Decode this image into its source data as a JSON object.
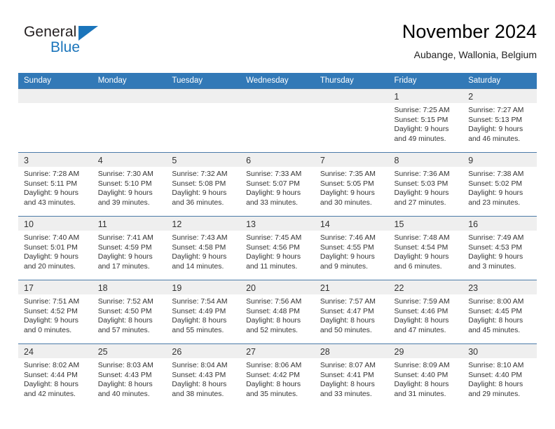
{
  "logo": {
    "word_one": "General",
    "word_two": "Blue",
    "triangle_icon": "blue-triangle-icon",
    "accent_color": "#1b75bb"
  },
  "header": {
    "title": "November 2024",
    "subtitle": "Aubange, Wallonia, Belgium",
    "header_bg_color": "#3279b7",
    "daynum_band_color": "#efefef"
  },
  "weekdays": [
    "Sunday",
    "Monday",
    "Tuesday",
    "Wednesday",
    "Thursday",
    "Friday",
    "Saturday"
  ],
  "weeks": [
    [
      {
        "day": "",
        "sunrise": "",
        "sunset": "",
        "daylight_line1": "",
        "daylight_line2": ""
      },
      {
        "day": "",
        "sunrise": "",
        "sunset": "",
        "daylight_line1": "",
        "daylight_line2": ""
      },
      {
        "day": "",
        "sunrise": "",
        "sunset": "",
        "daylight_line1": "",
        "daylight_line2": ""
      },
      {
        "day": "",
        "sunrise": "",
        "sunset": "",
        "daylight_line1": "",
        "daylight_line2": ""
      },
      {
        "day": "",
        "sunrise": "",
        "sunset": "",
        "daylight_line1": "",
        "daylight_line2": ""
      },
      {
        "day": "1",
        "sunrise": "Sunrise: 7:25 AM",
        "sunset": "Sunset: 5:15 PM",
        "daylight_line1": "Daylight: 9 hours",
        "daylight_line2": "and 49 minutes."
      },
      {
        "day": "2",
        "sunrise": "Sunrise: 7:27 AM",
        "sunset": "Sunset: 5:13 PM",
        "daylight_line1": "Daylight: 9 hours",
        "daylight_line2": "and 46 minutes."
      }
    ],
    [
      {
        "day": "3",
        "sunrise": "Sunrise: 7:28 AM",
        "sunset": "Sunset: 5:11 PM",
        "daylight_line1": "Daylight: 9 hours",
        "daylight_line2": "and 43 minutes."
      },
      {
        "day": "4",
        "sunrise": "Sunrise: 7:30 AM",
        "sunset": "Sunset: 5:10 PM",
        "daylight_line1": "Daylight: 9 hours",
        "daylight_line2": "and 39 minutes."
      },
      {
        "day": "5",
        "sunrise": "Sunrise: 7:32 AM",
        "sunset": "Sunset: 5:08 PM",
        "daylight_line1": "Daylight: 9 hours",
        "daylight_line2": "and 36 minutes."
      },
      {
        "day": "6",
        "sunrise": "Sunrise: 7:33 AM",
        "sunset": "Sunset: 5:07 PM",
        "daylight_line1": "Daylight: 9 hours",
        "daylight_line2": "and 33 minutes."
      },
      {
        "day": "7",
        "sunrise": "Sunrise: 7:35 AM",
        "sunset": "Sunset: 5:05 PM",
        "daylight_line1": "Daylight: 9 hours",
        "daylight_line2": "and 30 minutes."
      },
      {
        "day": "8",
        "sunrise": "Sunrise: 7:36 AM",
        "sunset": "Sunset: 5:03 PM",
        "daylight_line1": "Daylight: 9 hours",
        "daylight_line2": "and 27 minutes."
      },
      {
        "day": "9",
        "sunrise": "Sunrise: 7:38 AM",
        "sunset": "Sunset: 5:02 PM",
        "daylight_line1": "Daylight: 9 hours",
        "daylight_line2": "and 23 minutes."
      }
    ],
    [
      {
        "day": "10",
        "sunrise": "Sunrise: 7:40 AM",
        "sunset": "Sunset: 5:01 PM",
        "daylight_line1": "Daylight: 9 hours",
        "daylight_line2": "and 20 minutes."
      },
      {
        "day": "11",
        "sunrise": "Sunrise: 7:41 AM",
        "sunset": "Sunset: 4:59 PM",
        "daylight_line1": "Daylight: 9 hours",
        "daylight_line2": "and 17 minutes."
      },
      {
        "day": "12",
        "sunrise": "Sunrise: 7:43 AM",
        "sunset": "Sunset: 4:58 PM",
        "daylight_line1": "Daylight: 9 hours",
        "daylight_line2": "and 14 minutes."
      },
      {
        "day": "13",
        "sunrise": "Sunrise: 7:45 AM",
        "sunset": "Sunset: 4:56 PM",
        "daylight_line1": "Daylight: 9 hours",
        "daylight_line2": "and 11 minutes."
      },
      {
        "day": "14",
        "sunrise": "Sunrise: 7:46 AM",
        "sunset": "Sunset: 4:55 PM",
        "daylight_line1": "Daylight: 9 hours",
        "daylight_line2": "and 9 minutes."
      },
      {
        "day": "15",
        "sunrise": "Sunrise: 7:48 AM",
        "sunset": "Sunset: 4:54 PM",
        "daylight_line1": "Daylight: 9 hours",
        "daylight_line2": "and 6 minutes."
      },
      {
        "day": "16",
        "sunrise": "Sunrise: 7:49 AM",
        "sunset": "Sunset: 4:53 PM",
        "daylight_line1": "Daylight: 9 hours",
        "daylight_line2": "and 3 minutes."
      }
    ],
    [
      {
        "day": "17",
        "sunrise": "Sunrise: 7:51 AM",
        "sunset": "Sunset: 4:52 PM",
        "daylight_line1": "Daylight: 9 hours",
        "daylight_line2": "and 0 minutes."
      },
      {
        "day": "18",
        "sunrise": "Sunrise: 7:52 AM",
        "sunset": "Sunset: 4:50 PM",
        "daylight_line1": "Daylight: 8 hours",
        "daylight_line2": "and 57 minutes."
      },
      {
        "day": "19",
        "sunrise": "Sunrise: 7:54 AM",
        "sunset": "Sunset: 4:49 PM",
        "daylight_line1": "Daylight: 8 hours",
        "daylight_line2": "and 55 minutes."
      },
      {
        "day": "20",
        "sunrise": "Sunrise: 7:56 AM",
        "sunset": "Sunset: 4:48 PM",
        "daylight_line1": "Daylight: 8 hours",
        "daylight_line2": "and 52 minutes."
      },
      {
        "day": "21",
        "sunrise": "Sunrise: 7:57 AM",
        "sunset": "Sunset: 4:47 PM",
        "daylight_line1": "Daylight: 8 hours",
        "daylight_line2": "and 50 minutes."
      },
      {
        "day": "22",
        "sunrise": "Sunrise: 7:59 AM",
        "sunset": "Sunset: 4:46 PM",
        "daylight_line1": "Daylight: 8 hours",
        "daylight_line2": "and 47 minutes."
      },
      {
        "day": "23",
        "sunrise": "Sunrise: 8:00 AM",
        "sunset": "Sunset: 4:45 PM",
        "daylight_line1": "Daylight: 8 hours",
        "daylight_line2": "and 45 minutes."
      }
    ],
    [
      {
        "day": "24",
        "sunrise": "Sunrise: 8:02 AM",
        "sunset": "Sunset: 4:44 PM",
        "daylight_line1": "Daylight: 8 hours",
        "daylight_line2": "and 42 minutes."
      },
      {
        "day": "25",
        "sunrise": "Sunrise: 8:03 AM",
        "sunset": "Sunset: 4:43 PM",
        "daylight_line1": "Daylight: 8 hours",
        "daylight_line2": "and 40 minutes."
      },
      {
        "day": "26",
        "sunrise": "Sunrise: 8:04 AM",
        "sunset": "Sunset: 4:43 PM",
        "daylight_line1": "Daylight: 8 hours",
        "daylight_line2": "and 38 minutes."
      },
      {
        "day": "27",
        "sunrise": "Sunrise: 8:06 AM",
        "sunset": "Sunset: 4:42 PM",
        "daylight_line1": "Daylight: 8 hours",
        "daylight_line2": "and 35 minutes."
      },
      {
        "day": "28",
        "sunrise": "Sunrise: 8:07 AM",
        "sunset": "Sunset: 4:41 PM",
        "daylight_line1": "Daylight: 8 hours",
        "daylight_line2": "and 33 minutes."
      },
      {
        "day": "29",
        "sunrise": "Sunrise: 8:09 AM",
        "sunset": "Sunset: 4:40 PM",
        "daylight_line1": "Daylight: 8 hours",
        "daylight_line2": "and 31 minutes."
      },
      {
        "day": "30",
        "sunrise": "Sunrise: 8:10 AM",
        "sunset": "Sunset: 4:40 PM",
        "daylight_line1": "Daylight: 8 hours",
        "daylight_line2": "and 29 minutes."
      }
    ]
  ]
}
